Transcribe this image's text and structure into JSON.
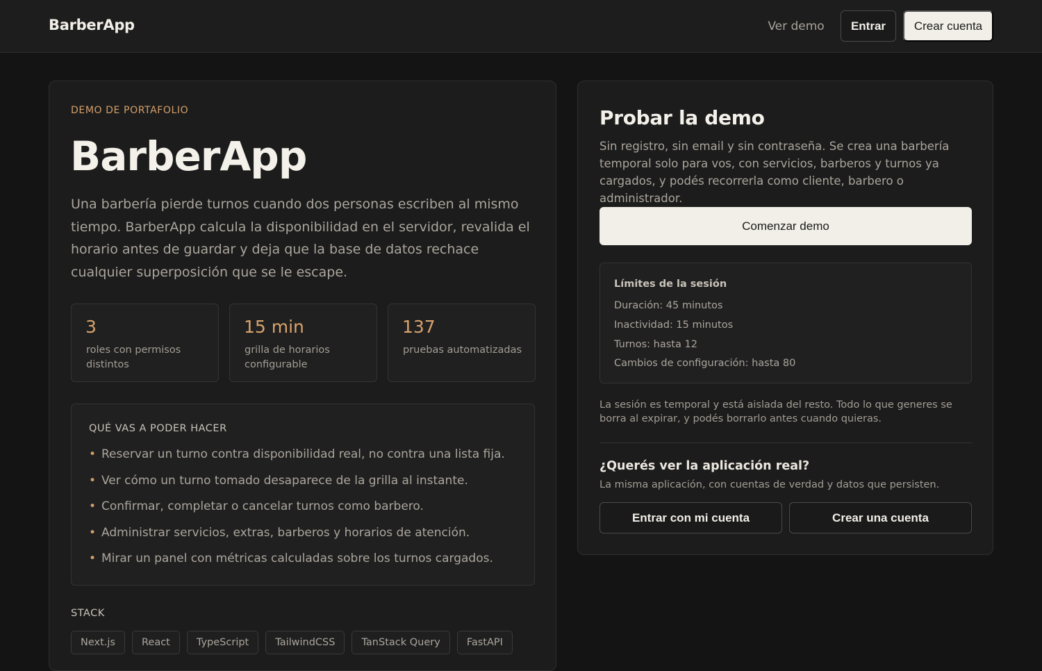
{
  "header": {
    "brand": "BarberApp",
    "nav": {
      "demo_label": "Ver demo",
      "login_label": "Entrar",
      "signup_label": "Crear cuenta"
    }
  },
  "hero": {
    "eyebrow": "DEMO DE PORTAFOLIO",
    "title": "BarberApp",
    "description": "Una barbería pierde turnos cuando dos personas escriben al mismo tiempo. BarberApp calcula la disponibilidad en el servidor, revalida el horario antes de guardar y deja que la base de datos rechace cualquier superposición que se le escape.",
    "stats": [
      {
        "value": "3",
        "label": "roles con permisos distintos"
      },
      {
        "value": "15 min",
        "label": "grilla de horarios configurable"
      },
      {
        "value": "137",
        "label": "pruebas automatizadas"
      }
    ]
  },
  "features": {
    "title": "QUÉ VAS A PODER HACER",
    "items": [
      "Reservar un turno contra disponibilidad real, no contra una lista fija.",
      "Ver cómo un turno tomado desaparece de la grilla al instante.",
      "Confirmar, completar o cancelar turnos como barbero.",
      "Administrar servicios, extras, barberos y horarios de atención.",
      "Mirar un panel con métricas calculadas sobre los turnos cargados."
    ]
  },
  "stack": {
    "title": "STACK",
    "tags": [
      "Next.js",
      "React",
      "TypeScript",
      "TailwindCSS",
      "TanStack Query",
      "FastAPI"
    ]
  },
  "demo": {
    "title": "Probar la demo",
    "description": "Sin registro, sin email y sin contraseña. Se crea una barbería temporal solo para vos, con servicios, barberos y turnos ya cargados, y podés recorrerla como cliente, barbero o administrador.",
    "start_label": "Comenzar demo",
    "limits": {
      "title": "Límites de la sesión",
      "items": [
        "Duración: 45 minutos",
        "Inactividad: 15 minutos",
        "Turnos: hasta 12",
        "Cambios de configuración: hasta 80"
      ]
    },
    "note": "La sesión es temporal y está aislada del resto. Todo lo que generes se borra al expirar, y podés borrarlo antes cuando quieras.",
    "real": {
      "title": "¿Querés ver la aplicación real?",
      "description": "La misma aplicación, con cuentas de verdad y datos que persisten.",
      "login_label": "Entrar con mi cuenta",
      "signup_label": "Crear una cuenta"
    }
  }
}
